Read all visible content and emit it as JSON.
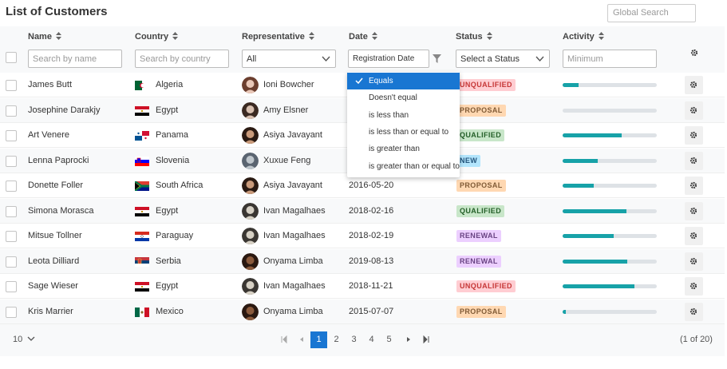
{
  "title": "List of Customers",
  "global_search": {
    "placeholder": "Global Search"
  },
  "columns": {
    "name": "Name",
    "country": "Country",
    "representative": "Representative",
    "date": "Date",
    "status": "Status",
    "activity": "Activity"
  },
  "filters": {
    "name_placeholder": "Search by name",
    "country_placeholder": "Search by country",
    "representative_value": "All",
    "date_value": "Registration Date",
    "status_placeholder": "Select a Status",
    "activity_placeholder": "Minimum"
  },
  "date_match_menu": {
    "selected": "Equals",
    "options": [
      "Equals",
      "Doesn't equal",
      "is less than",
      "is less than or equal to",
      "is greater than",
      "is greater than or equal to"
    ]
  },
  "rows": [
    {
      "name": "James Butt",
      "country": "Algeria",
      "flag": "algeria-flag",
      "representative": "Ioni Bowcher",
      "date": "",
      "status": "UNQUALIFIED",
      "activity": 0.17
    },
    {
      "name": "Josephine Darakjy",
      "country": "Egypt",
      "flag": "egypt-flag",
      "representative": "Amy Elsner",
      "date": "",
      "status": "PROPOSAL",
      "activity": 0.0
    },
    {
      "name": "Art Venere",
      "country": "Panama",
      "flag": "panama-flag",
      "representative": "Asiya Javayant",
      "date": "",
      "status": "QUALIFIED",
      "activity": 0.63
    },
    {
      "name": "Lenna Paprocki",
      "country": "Slovenia",
      "flag": "slovenia-flag",
      "representative": "Xuxue Feng",
      "date": "",
      "status": "NEW",
      "activity": 0.37
    },
    {
      "name": "Donette Foller",
      "country": "South Africa",
      "flag": "south-africa-flag",
      "representative": "Asiya Javayant",
      "date": "2016-05-20",
      "status": "PROPOSAL",
      "activity": 0.33
    },
    {
      "name": "Simona Morasca",
      "country": "Egypt",
      "flag": "egypt-flag",
      "representative": "Ivan Magalhaes",
      "date": "2018-02-16",
      "status": "QUALIFIED",
      "activity": 0.68
    },
    {
      "name": "Mitsue Tollner",
      "country": "Paraguay",
      "flag": "paraguay-flag",
      "representative": "Ivan Magalhaes",
      "date": "2018-02-19",
      "status": "RENEWAL",
      "activity": 0.54
    },
    {
      "name": "Leota Dilliard",
      "country": "Serbia",
      "flag": "serbia-flag",
      "representative": "Onyama Limba",
      "date": "2019-08-13",
      "status": "RENEWAL",
      "activity": 0.69
    },
    {
      "name": "Sage Wieser",
      "country": "Egypt",
      "flag": "egypt-flag",
      "representative": "Ivan Magalhaes",
      "date": "2018-11-21",
      "status": "UNQUALIFIED",
      "activity": 0.76
    },
    {
      "name": "Kris Marrier",
      "country": "Mexico",
      "flag": "mexico-flag",
      "representative": "Onyama Limba",
      "date": "2015-07-07",
      "status": "PROPOSAL",
      "activity": 0.03
    }
  ],
  "paginator": {
    "rows_per_page": "10",
    "pages": [
      "1",
      "2",
      "3",
      "4",
      "5"
    ],
    "current_page": "1",
    "report": "(1 of 20)"
  },
  "colors": {
    "accent": "#1976d2",
    "progress": "#17a2a8"
  }
}
